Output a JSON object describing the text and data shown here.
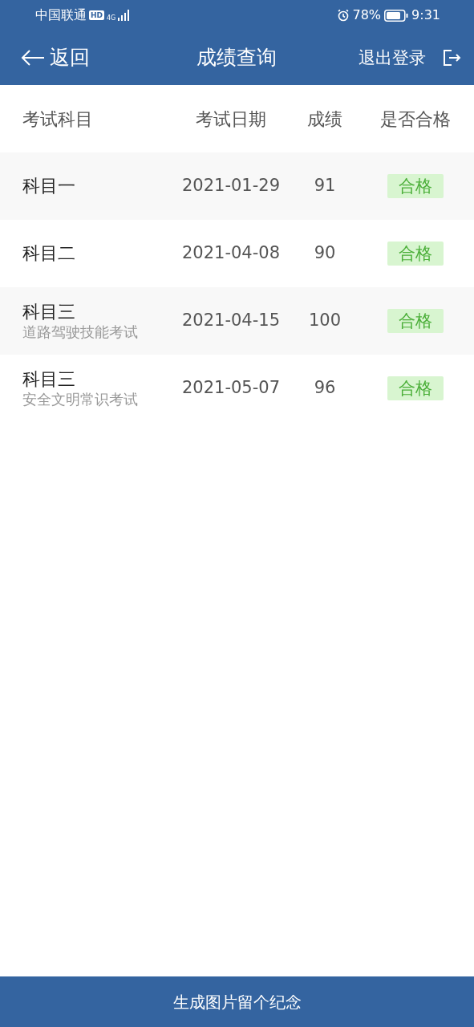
{
  "status_bar": {
    "carrier": "中国联通",
    "hd": "HD",
    "network": "4G",
    "battery": "78%",
    "time": "9:31"
  },
  "header": {
    "back": "返回",
    "title": "成绩查询",
    "logout": "退出登录"
  },
  "table": {
    "columns": [
      "考试科目",
      "考试日期",
      "成绩",
      "是否合格"
    ],
    "rows": [
      {
        "subject": "科目一",
        "date": "2021-01-29",
        "score": "91",
        "result": "合格",
        "passed": true
      },
      {
        "subject": "科目二",
        "date": "2021-04-08",
        "score": "90",
        "result": "合格",
        "passed": true
      },
      {
        "subject": "科目三",
        "note": "道路驾驶技能考试",
        "date": "2021-04-15",
        "score": "100",
        "result": "合格",
        "passed": true
      },
      {
        "subject": "科目三",
        "note": "安全文明常识考试",
        "date": "2021-05-07",
        "score": "96",
        "result": "合格",
        "passed": true
      }
    ]
  },
  "footer_button": "生成图片留个纪念"
}
